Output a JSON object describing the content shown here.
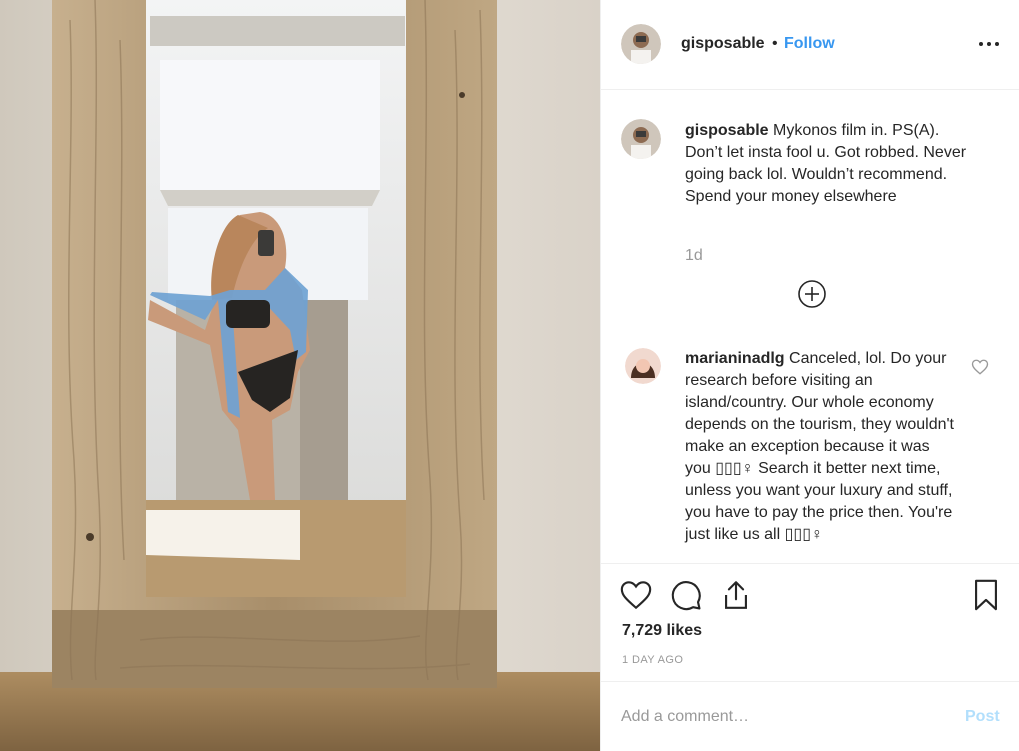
{
  "post": {
    "photo_alt": "Mirror selfie in a rustic wooden frame",
    "photo_colors": {
      "wall": "#e6e0d7",
      "wood": "#b39a78",
      "floor": "#a48458",
      "shirt": "#6f9fce"
    }
  },
  "header": {
    "username": "gisposable",
    "separator": "•",
    "follow_label": "Follow",
    "more_icon": "more-horizontal-icon"
  },
  "caption": {
    "username": "gisposable",
    "text": "Mykonos film in. PS(A). Don’t let insta fool u. Got robbed. Never going back lol. Wouldn’t recommend. Spend your money elsewhere",
    "age": "1d"
  },
  "load_more_icon": "plus-circle-icon",
  "comments": [
    {
      "username": "marianinadlg",
      "text": "Canceled, lol. Do your research before visiting an island/country. Our whole economy depends on the tourism, they wouldn't make an exception because it was you ▯▯▯♀ Search it better next time, unless you want your luxury and stuff, you have to pay the price then. You're just like us all ▯▯▯♀",
      "like_icon": "heart-outline-icon"
    }
  ],
  "actions": {
    "like_icon": "heart-outline-icon",
    "comment_icon": "comment-bubble-icon",
    "share_icon": "share-upload-icon",
    "save_icon": "bookmark-icon",
    "likes_count": "7,729 likes",
    "time_ago": "1 DAY AGO"
  },
  "comment_box": {
    "placeholder": "Add a comment…",
    "post_label": "Post"
  },
  "colors": {
    "accent": "#3897f0",
    "post_disabled": "#b2dffc",
    "muted": "#999999",
    "text": "#262626"
  }
}
